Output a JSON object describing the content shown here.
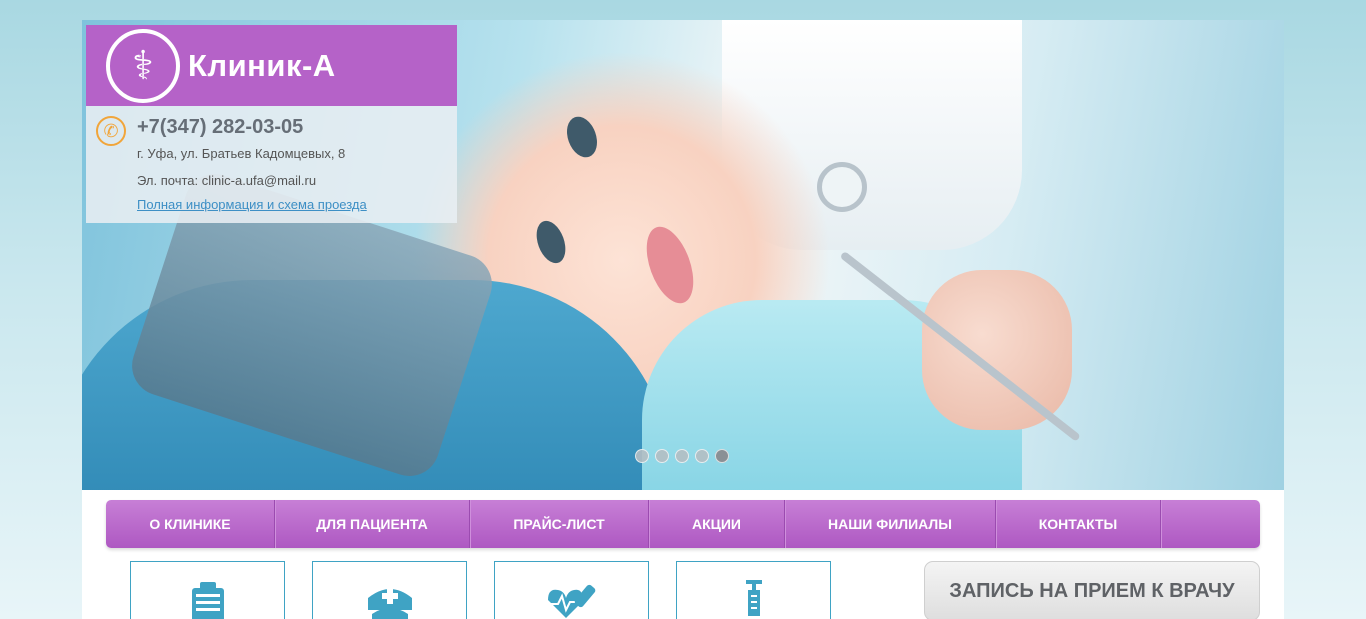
{
  "brand": {
    "name": "Клиник-А",
    "emblem_icon": "caduceus-icon",
    "color": "#b562c8"
  },
  "contact": {
    "phone": "+7(347) 282-03-05",
    "address": "г. Уфа, ул. Братьев Кадомцевых, 8",
    "email": "Эл. почта: clinic-a.ufa@mail.ru",
    "full_info_link": "Полная информация и схема проезда"
  },
  "slider": {
    "total_slides": 5,
    "active_slide": 5
  },
  "nav": {
    "items": [
      {
        "label": "О клинике"
      },
      {
        "label": "Для пациента"
      },
      {
        "label": "Прайс-лист"
      },
      {
        "label": "Акции"
      },
      {
        "label": "Наши филиалы"
      },
      {
        "label": "Контакты"
      }
    ]
  },
  "services": [
    {
      "icon": "clipboard-icon"
    },
    {
      "icon": "nurse-icon"
    },
    {
      "icon": "heart-cardiogram-icon"
    },
    {
      "icon": "syringe-icon"
    }
  ],
  "appointment": {
    "title": "ЗАПИСЬ НА ПРИЕМ К ВРАЧУ"
  },
  "colors": {
    "accent": "#b562c8",
    "link": "#3d8fc5",
    "service_border": "#3fa3c4",
    "phone_icon": "#f1a53a"
  }
}
